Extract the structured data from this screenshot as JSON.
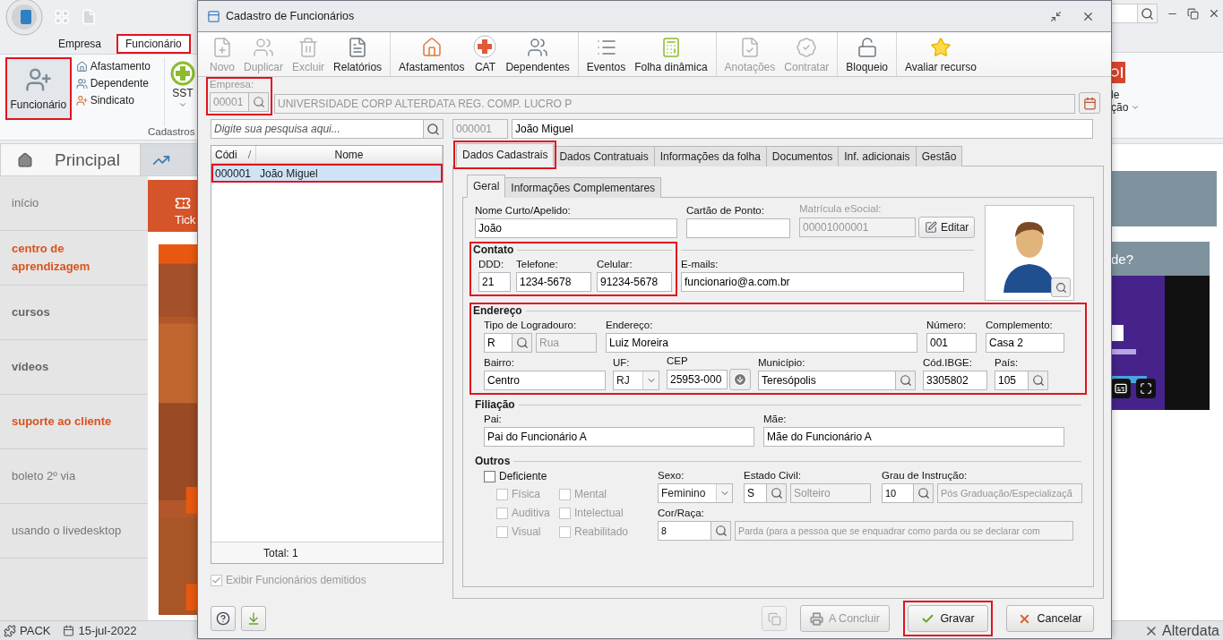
{
  "app": {
    "ribbon_tabs": [
      {
        "label": "Empresa",
        "selected": false,
        "highlighted": false
      },
      {
        "label": "Funcionário",
        "selected": true,
        "highlighted": true
      }
    ],
    "ribbon_large_button": {
      "label": "Funcionário",
      "highlighted": true
    },
    "ribbon_small_buttons": [
      "Afastamento",
      "Dependente",
      "Sindicato"
    ],
    "ribbon_cut_button": "SST",
    "ribbon_group": "Cadastros",
    "ribbon_right_label": [
      "le",
      "ção"
    ],
    "page_tab": "Principal",
    "nav_items": [
      {
        "label": "início",
        "kind": "plain"
      },
      {
        "label": "centro de aprendizagem",
        "kind": "accent"
      },
      {
        "label": "cursos",
        "kind": "strong"
      },
      {
        "label": "vídeos",
        "kind": "strong"
      },
      {
        "label": "suporte ao cliente",
        "kind": "accent"
      },
      {
        "label": "boleto 2º via",
        "kind": "plain"
      },
      {
        "label": "usando o livedesktop",
        "kind": "plain"
      }
    ],
    "ticket_tile": "Tick",
    "help_heading": "de?",
    "status": {
      "pack": "PACK",
      "date": "15-jul-2022",
      "brand": "Alterdata"
    }
  },
  "dialog": {
    "title": "Cadastro de Funcionários",
    "toolbar": [
      {
        "items": [
          {
            "label": "Novo",
            "disabled": true
          },
          {
            "label": "Duplicar",
            "disabled": true
          },
          {
            "label": "Excluir",
            "disabled": true
          },
          {
            "label": "Relatórios",
            "disabled": false
          }
        ]
      },
      {
        "items": [
          {
            "label": "Afastamentos",
            "disabled": false
          },
          {
            "label": "CAT",
            "disabled": false
          },
          {
            "label": "Dependentes",
            "disabled": false
          }
        ]
      },
      {
        "items": [
          {
            "label": "Eventos",
            "disabled": false
          },
          {
            "label": "Folha dinâmica",
            "disabled": false
          }
        ]
      },
      {
        "items": [
          {
            "label": "Anotações",
            "disabled": true
          },
          {
            "label": "Contratar",
            "disabled": true
          }
        ]
      },
      {
        "items": [
          {
            "label": "Bloqueio",
            "disabled": false
          }
        ]
      },
      {
        "items": [
          {
            "label": "Avaliar recurso",
            "disabled": false
          }
        ]
      }
    ],
    "company": {
      "label": "Empresa:",
      "code": "00001",
      "name": "UNIVERSIDADE CORP ALTERDATA REG. COMP. LUCRO P",
      "highlighted": true
    },
    "search": {
      "placeholder": "Digite sua pesquisa aqui..."
    },
    "employee_list": {
      "columns": [
        "Códi",
        "Nome"
      ],
      "rows": [
        {
          "code": "000001",
          "name": "João Miguel",
          "selected": true,
          "highlighted": true
        }
      ],
      "total": "Total: 1"
    },
    "show_dismissed": {
      "label": "Exibir Funcionários demitidos",
      "checked": true,
      "disabled": true
    },
    "employee": {
      "code": "000001",
      "name": "João Miguel"
    },
    "tabs": [
      {
        "label": "Dados Cadastrais",
        "selected": true,
        "highlighted": true
      },
      {
        "label": "Dados Contratuais",
        "selected": false,
        "highlighted": false
      },
      {
        "label": "Informações da folha",
        "selected": false,
        "highlighted": false
      },
      {
        "label": "Documentos",
        "selected": false,
        "highlighted": false
      },
      {
        "label": "Inf. adicionais",
        "selected": false,
        "highlighted": false
      },
      {
        "label": "Gestão",
        "selected": false,
        "highlighted": false
      }
    ],
    "subtabs": [
      {
        "label": "Geral",
        "selected": true
      },
      {
        "label": "Informações Complementares",
        "selected": false
      }
    ],
    "general": {
      "nickname": {
        "label": "Nome Curto/Apelido:",
        "value": "João"
      },
      "time_card": {
        "label": "Cartão de Ponto:"
      },
      "esocial": {
        "label": "Matrícula eSocial:",
        "value": "00001000001",
        "disabled": true
      },
      "edit_button": "Editar",
      "contact": {
        "title": "Contato",
        "highlighted": true,
        "fields": [
          {
            "label": "DDD:",
            "value": "21"
          },
          {
            "label": "Telefone:",
            "value": "1234-5678"
          },
          {
            "label": "Celular:",
            "value": "91234-5678"
          }
        ],
        "emails": {
          "label": "E-mails:",
          "value": "funcionario@a.com.br"
        }
      },
      "address": {
        "title": "Endereço",
        "highlighted": true,
        "street_type": {
          "label": "Tipo de Logradouro:",
          "value": "R",
          "description": "Rua"
        },
        "street": {
          "label": "Endereço:",
          "value": "Luiz Moreira"
        },
        "number": {
          "label": "Número:",
          "value": "001"
        },
        "complement": {
          "label": "Complemento:",
          "value": "Casa 2"
        },
        "district": {
          "label": "Bairro:",
          "value": "Centro"
        },
        "state": {
          "label": "UF:",
          "value": "RJ"
        },
        "zip": {
          "label": "CEP",
          "value": "25953-000"
        },
        "city": {
          "label": "Município:",
          "value": "Teresópolis"
        },
        "ibge": {
          "label": "Cód.IBGE:",
          "value": "3305802"
        },
        "country": {
          "label": "País:",
          "value": "105"
        }
      },
      "parents": {
        "title": "Filiação",
        "father": {
          "label": "Pai:",
          "value": "Pai do Funcionário A"
        },
        "mother": {
          "label": "Mãe:",
          "value": "Mãe do Funcionário A"
        }
      },
      "others": {
        "title": "Outros",
        "disabled_person": {
          "label": "Deficiente",
          "checked": false
        },
        "disability_types": [
          {
            "label": "Física",
            "checked": false,
            "disabled": true
          },
          {
            "label": "Mental",
            "checked": false,
            "disabled": true
          },
          {
            "label": "Auditiva",
            "checked": false,
            "disabled": true
          },
          {
            "label": "Intelectual",
            "checked": false,
            "disabled": true
          },
          {
            "label": "Visual",
            "checked": false,
            "disabled": true
          },
          {
            "label": "Reabilitado",
            "checked": false,
            "disabled": true
          }
        ],
        "sex": {
          "label": "Sexo:",
          "value": "Feminino"
        },
        "marital_status": {
          "label": "Estado Civil:",
          "value": "S",
          "description": "Solteiro"
        },
        "education": {
          "label": "Grau de Instrução:",
          "value": "10",
          "description": "Pós Graduação/Especializaçã"
        },
        "race": {
          "label": "Cor/Raça:",
          "value": "8",
          "description": "Parda (para a pessoa que se enquadrar como parda ou se declarar com"
        }
      }
    },
    "buttons": [
      {
        "label": "A Concluir",
        "kind": "conclude",
        "disabled": true,
        "highlighted": false
      },
      {
        "label": "Gravar",
        "kind": "save",
        "disabled": false,
        "highlighted": true
      },
      {
        "label": "Cancelar",
        "kind": "cancel",
        "disabled": false,
        "highlighted": false
      }
    ]
  }
}
